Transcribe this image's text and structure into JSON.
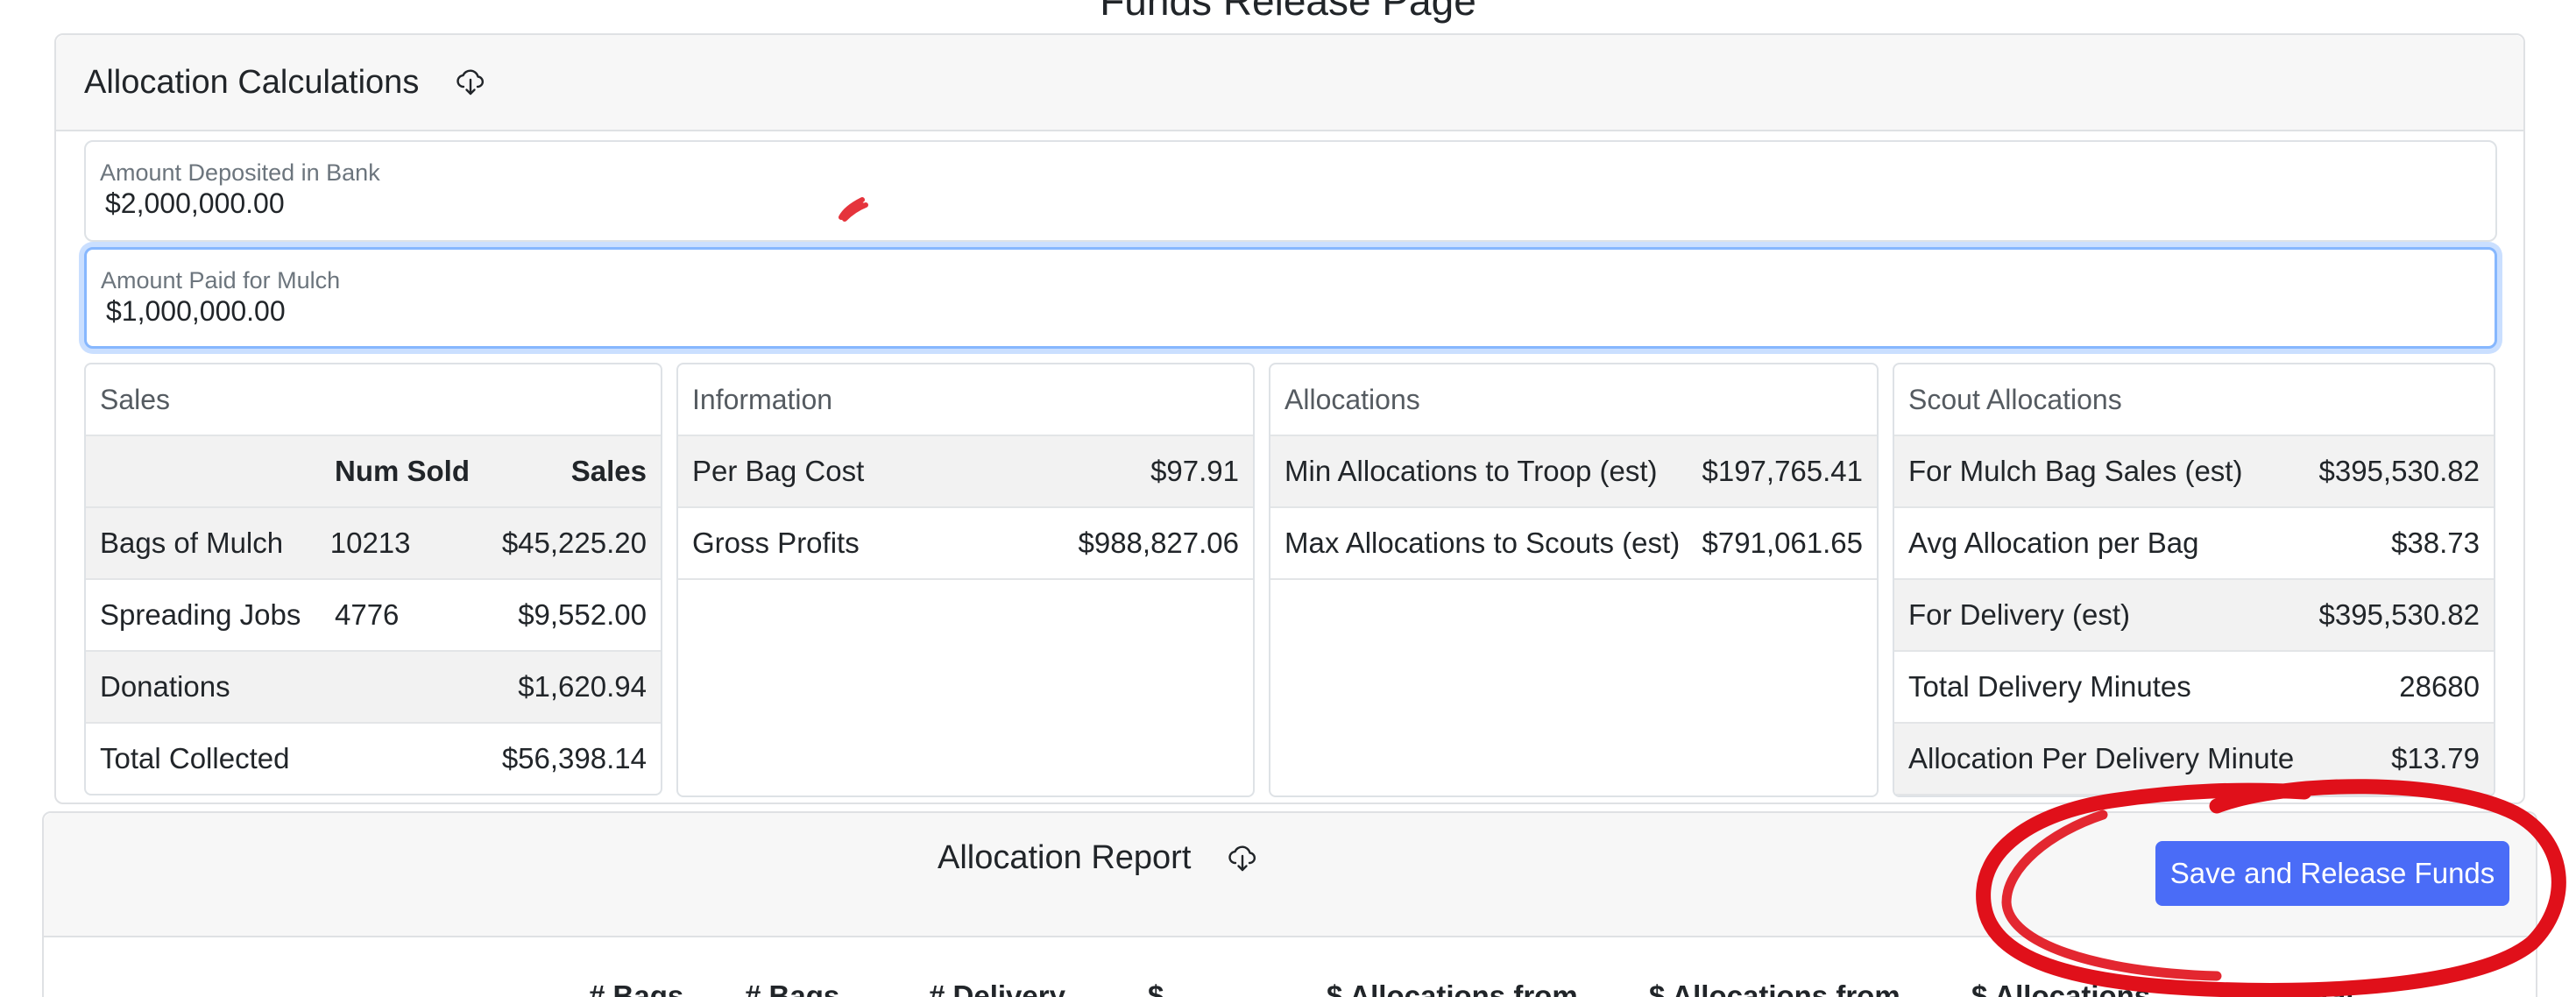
{
  "page": {
    "title": "Funds Release Page"
  },
  "allocation_calculations": {
    "title": "Allocation Calculations",
    "download_icon": "cloud-download-icon",
    "fields": {
      "deposited": {
        "label": "Amount Deposited in Bank",
        "value": "$2,000,000.00"
      },
      "mulch_paid": {
        "label": "Amount Paid for Mulch",
        "value": "$1,000,000.00"
      }
    },
    "sales": {
      "title": "Sales",
      "headers": {
        "num_sold": "Num Sold",
        "sales": "Sales"
      },
      "rows": [
        {
          "label": "Bags of Mulch",
          "num": "10213",
          "amount": "$45,225.20"
        },
        {
          "label": "Spreading Jobs",
          "num": "4776",
          "amount": "$9,552.00"
        },
        {
          "label": "Donations",
          "num": "",
          "amount": "$1,620.94"
        },
        {
          "label": "Total Collected",
          "num": "",
          "amount": "$56,398.14"
        }
      ]
    },
    "information": {
      "title": "Information",
      "rows": [
        {
          "label": "Per Bag Cost",
          "value": "$97.91"
        },
        {
          "label": "Gross Profits",
          "value": "$988,827.06"
        }
      ]
    },
    "allocations": {
      "title": "Allocations",
      "rows": [
        {
          "label": "Min Allocations to Troop (est)",
          "value": "$197,765.41"
        },
        {
          "label": "Max Allocations to Scouts (est)",
          "value": "$791,061.65"
        }
      ]
    },
    "scout_allocations": {
      "title": "Scout Allocations",
      "rows": [
        {
          "label": "For Mulch Bag Sales (est)",
          "value": "$395,530.82"
        },
        {
          "label": "Avg Allocation per Bag",
          "value": "$38.73"
        },
        {
          "label": "For Delivery (est)",
          "value": "$395,530.82"
        },
        {
          "label": "Total Delivery Minutes",
          "value": "28680"
        },
        {
          "label": "Allocation Per Delivery Minute",
          "value": "$13.79"
        }
      ]
    }
  },
  "allocation_report": {
    "title": "Allocation Report",
    "download_icon": "cloud-download-icon",
    "release_button_label": "Save and Release Funds",
    "columns": [
      "# Bags",
      "# Bags",
      "# Delivery",
      "$",
      "$ Allocations from",
      "$ Allocations from",
      "$ Allocations",
      "Total"
    ]
  },
  "colors": {
    "primary_button": "#4a6cf7",
    "focus_ring": "#86b7fe",
    "annotation_red": "#e0101a"
  }
}
